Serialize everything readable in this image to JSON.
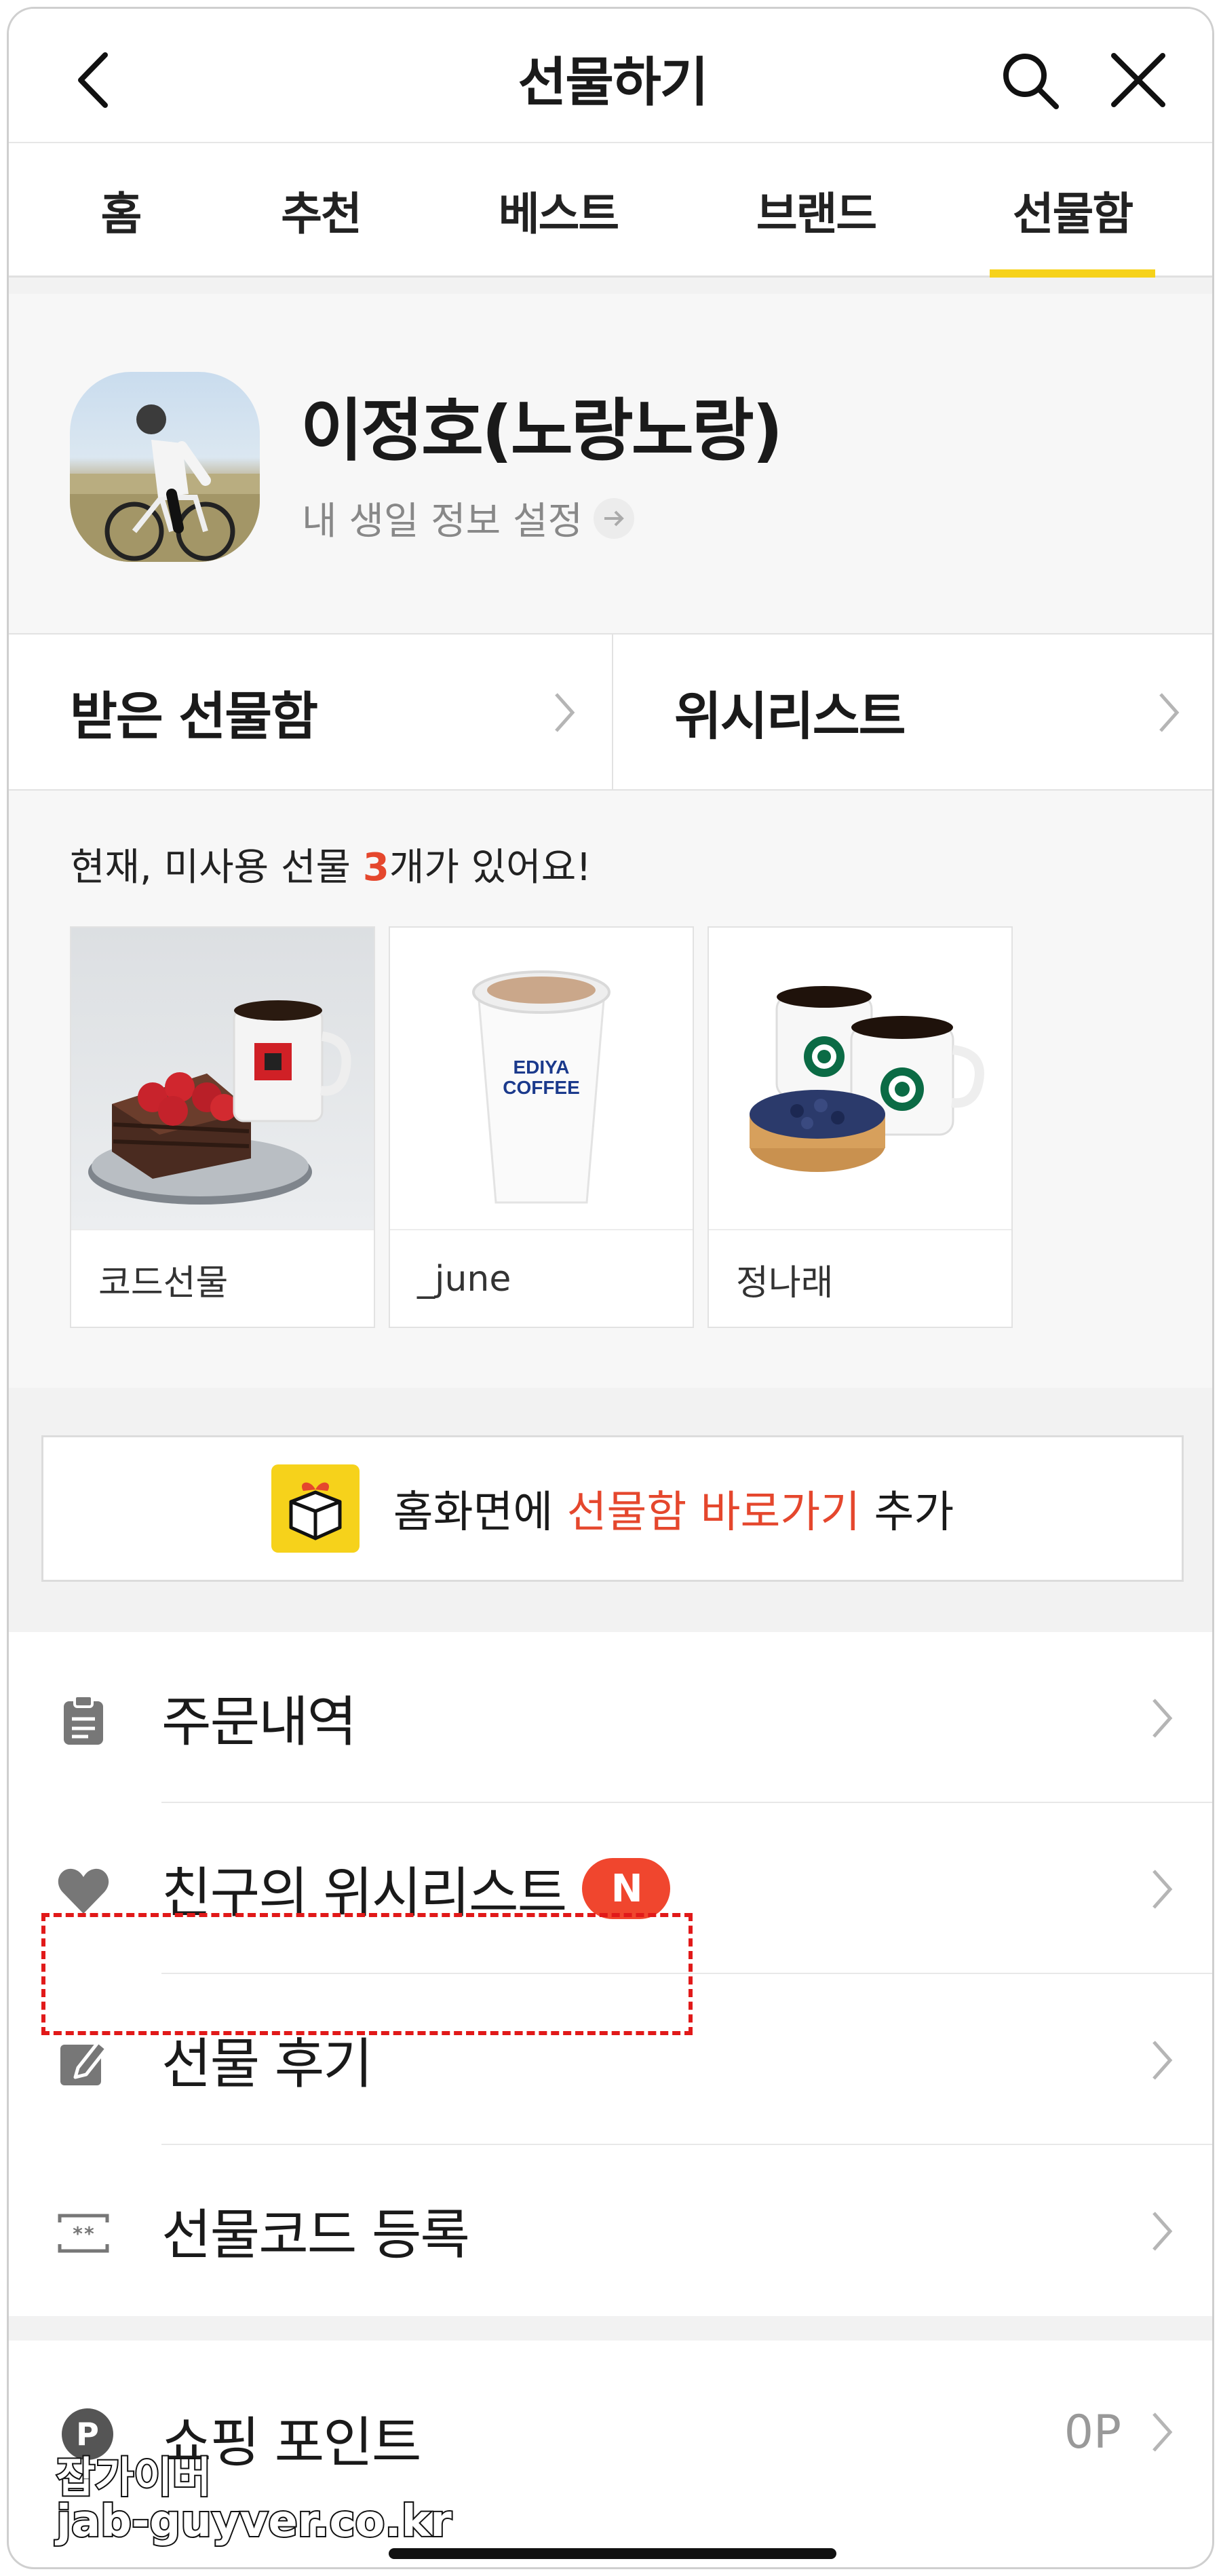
{
  "header": {
    "title": "선물하기",
    "back_icon": "chevron-left-icon",
    "search_icon": "search-icon",
    "close_icon": "close-icon"
  },
  "tabs": [
    {
      "label": "홈",
      "active": false
    },
    {
      "label": "추천",
      "active": false
    },
    {
      "label": "베스트",
      "active": false
    },
    {
      "label": "브랜드",
      "active": false
    },
    {
      "label": "선물함",
      "active": true
    }
  ],
  "accent_color": "#f6d21b",
  "highlight_color": "#e5472d",
  "profile": {
    "name": "이정호(노랑노랑)",
    "subtitle": "내 생일 정보 설정"
  },
  "boxes": {
    "received": "받은 선물함",
    "wishlist": "위시리스트"
  },
  "unused": {
    "prefix": "현재, 미사용 선물 ",
    "count": "3",
    "suffix": "개가 있어요!"
  },
  "gifts": [
    {
      "sender": "코드선물"
    },
    {
      "sender": "_june",
      "cup_text": "EDIYA COFFEE"
    },
    {
      "sender": "정나래"
    }
  ],
  "banner": {
    "prefix": "홈화면에 ",
    "highlight": "선물함 바로가기",
    "suffix": " 추가"
  },
  "menu": [
    {
      "label": "주문내역",
      "icon": "clipboard-icon"
    },
    {
      "label": "친구의 위시리스트",
      "icon": "heart-icon",
      "badge": "N"
    },
    {
      "label": "선물 후기",
      "icon": "edit-icon"
    },
    {
      "label": "선물코드 등록",
      "icon": "gift-code-icon",
      "highlighted": true
    }
  ],
  "points": {
    "label": "쇼핑 포인트",
    "icon_letter": "P",
    "value": "0P"
  },
  "watermark": {
    "line1": "잡가이버",
    "line2": "jab-guyver.co.kr"
  }
}
